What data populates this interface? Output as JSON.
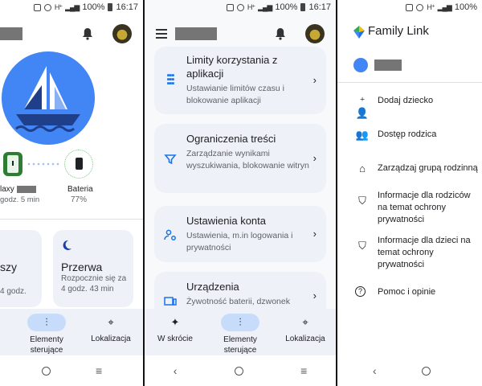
{
  "status_bar": {
    "battery": "100%",
    "time": "16:17",
    "network": "H⁺"
  },
  "panel_home": {
    "device_name_partial": "laxy",
    "device_time_partial": "godz. 5 min",
    "battery_label": "Bateria",
    "battery_value": "77%",
    "card1_title_partial": "szy",
    "card1_sub_partial": "4 godz.",
    "card2_title": "Przerwa",
    "card2_sub": "Rozpocznie się za 4 godz. 43 min",
    "nav": {
      "controls": "Elementy sterujące",
      "location": "Lokalizacja"
    }
  },
  "panel_settings": {
    "items": [
      {
        "title": "Limity korzystania z aplikacji",
        "desc": "Ustawianie limitów czasu i blokowanie aplikacji",
        "icon": "grid-icon"
      },
      {
        "title": "Ograniczenia treści",
        "desc": "Zarządzanie wynikami wyszukiwania, blokowanie witryn",
        "icon": "filter-icon"
      },
      {
        "title": "Ustawienia konta",
        "desc": "Ustawienia, m.in logowania i prywatności",
        "icon": "account-settings-icon"
      },
      {
        "title": "Urządzenia",
        "desc": "Żywotność baterii, dzwonek",
        "icon": "devices-icon"
      }
    ],
    "nav": {
      "overview": "W skrócie",
      "controls": "Elementy sterujące",
      "location": "Lokalizacja"
    }
  },
  "panel_menu": {
    "app_title": "Family Link",
    "items": [
      {
        "label": "Dodaj dziecko",
        "icon": "add-person-icon"
      },
      {
        "label": "Dostęp rodzica",
        "icon": "people-icon"
      },
      {
        "label": "Zarządzaj grupą rodzinną",
        "icon": "home-icon"
      },
      {
        "label": "Informacje dla rodziców na temat ochrony prywatności",
        "icon": "shield-icon"
      },
      {
        "label": "Informacje dla dzieci na temat ochrony prywatności",
        "icon": "shield-icon"
      },
      {
        "label": "Pomoc i opinie",
        "icon": "help-icon"
      }
    ]
  },
  "colors": {
    "accent": "#1a73e8",
    "nav_bg": "#eef1f8",
    "active_pill": "#c7dcfb",
    "logo_blue": "#4285f4"
  }
}
